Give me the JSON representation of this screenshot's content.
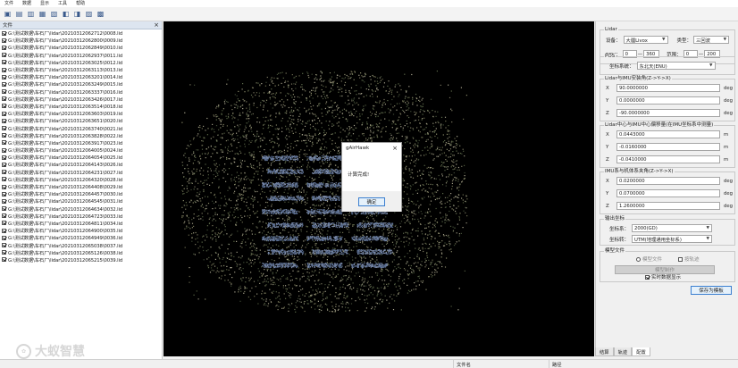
{
  "menu": [
    "文件",
    "数据",
    "显示",
    "工具",
    "帮助"
  ],
  "toolbar_icons": [
    "open-icon",
    "open-folder-icon",
    "save-icon",
    "import-icon",
    "export-icon",
    "layers-icon",
    "settings-icon",
    "image-icon",
    "view-icon"
  ],
  "file_panel": {
    "title": "文件",
    "close": "×",
    "files": [
      "G:\\测试数据\\车石厂\\lidar\\20210312062712\\0008.lid",
      "G:\\测试数据\\车石厂\\lidar\\20210312062800\\0009.lid",
      "G:\\测试数据\\车石厂\\lidar\\20210312062849\\0010.lid",
      "G:\\测试数据\\车石厂\\lidar\\20210312062937\\0011.lid",
      "G:\\测试数据\\车石厂\\lidar\\20210312063025\\0012.lid",
      "G:\\测试数据\\车石厂\\lidar\\20210312063113\\0013.lid",
      "G:\\测试数据\\车石厂\\lidar\\20210312063201\\0014.lid",
      "G:\\测试数据\\车石厂\\lidar\\20210312063249\\0015.lid",
      "G:\\测试数据\\车石厂\\lidar\\20210312063337\\0016.lid",
      "G:\\测试数据\\车石厂\\lidar\\20210312063426\\0017.lid",
      "G:\\测试数据\\车石厂\\lidar\\20210312063514\\0018.lid",
      "G:\\测试数据\\车石厂\\lidar\\20210312063603\\0019.lid",
      "G:\\测试数据\\车石厂\\lidar\\20210312063651\\0020.lid",
      "G:\\测试数据\\车石厂\\lidar\\20210312063740\\0021.lid",
      "G:\\测试数据\\车石厂\\lidar\\20210312063828\\0022.lid",
      "G:\\测试数据\\车石厂\\lidar\\20210312063917\\0023.lid",
      "G:\\测试数据\\车石厂\\lidar\\20210312064005\\0024.lid",
      "G:\\测试数据\\车石厂\\lidar\\20210312064054\\0025.lid",
      "G:\\测试数据\\车石厂\\lidar\\20210312064143\\0026.lid",
      "G:\\测试数据\\车石厂\\lidar\\20210312064231\\0027.lid",
      "G:\\测试数据\\车石厂\\lidar\\20210312064320\\0028.lid",
      "G:\\测试数据\\车石厂\\lidar\\20210312064408\\0029.lid",
      "G:\\测试数据\\车石厂\\lidar\\20210312064457\\0030.lid",
      "G:\\测试数据\\车石厂\\lidar\\20210312064545\\0031.lid",
      "G:\\测试数据\\车石厂\\lidar\\20210312064634\\0032.lid",
      "G:\\测试数据\\车石厂\\lidar\\20210312064723\\0033.lid",
      "G:\\测试数据\\车石厂\\lidar\\20210312064811\\0034.lid",
      "G:\\测试数据\\车石厂\\lidar\\20210312064900\\0035.lid",
      "G:\\测试数据\\车石厂\\lidar\\20210312064949\\0036.lid",
      "G:\\测试数据\\车石厂\\lidar\\20210312065038\\0037.lid",
      "G:\\测试数据\\车石厂\\lidar\\20210312065126\\0038.lid",
      "G:\\测试数据\\车石厂\\lidar\\20210312065215\\0039.lid"
    ]
  },
  "dialog": {
    "title": "gAirHawk",
    "close": "×",
    "message": "计算完成!",
    "ok_label": "确定"
  },
  "right_panel": {
    "lidar_group": "Lidar",
    "device_label": "设备：",
    "device_value": "大疆Livox",
    "type_label": "类型：",
    "type_value": "三回波",
    "fov_label": "FOV：",
    "fov_min": "0",
    "fov_dash": "—",
    "fov_max": "360",
    "range_label": "范围：",
    "range_min": "0",
    "range_max": "200",
    "pos_group": "POS",
    "coord_label": "坐标系统：",
    "coord_value": "东北天(ENU)",
    "lidar_rot_group": "Lidar与IMU安装角(Z->Y->X)",
    "rot": [
      {
        "axis": "X",
        "value": "90.0000000",
        "unit": "deg"
      },
      {
        "axis": "Y",
        "value": "0.0000000",
        "unit": "deg"
      },
      {
        "axis": "Z",
        "value": "-90.0000000",
        "unit": "deg"
      }
    ],
    "lidar_off_group": "Lidar中心与IMU中心偏移量(在IMU坐标系中测量)",
    "off": [
      {
        "axis": "X",
        "value": "0.0443000",
        "unit": "m"
      },
      {
        "axis": "Y",
        "value": "-0.0160000",
        "unit": "m"
      },
      {
        "axis": "Z",
        "value": "-0.0410000",
        "unit": "m"
      }
    ],
    "body_group": "IMU系与机体系夹角(Z->Y->X)",
    "body": [
      {
        "axis": "X",
        "value": "0.0200000",
        "unit": "deg"
      },
      {
        "axis": "Y",
        "value": "0.0700000",
        "unit": "deg"
      },
      {
        "axis": "Z",
        "value": "1.2600000",
        "unit": "deg"
      }
    ],
    "out_group": "输出坐标",
    "datum_label": "坐标系：",
    "datum_value": "2000(GD)",
    "proj_label": "坐标转：",
    "proj_value": "UTM(地理通用坐标系)",
    "model_group": "模型文件",
    "radio_label": "模型文件",
    "check_label": "按轨迹",
    "model_button": "模型制作",
    "realtime_label": "实时数据显示",
    "save_button": "保存为模板"
  },
  "bottom_tabs": [
    "结算",
    "轨迹",
    "配置"
  ],
  "status": {
    "file_label": "文件名",
    "path_label": "路径"
  },
  "watermark": "大蚁智慧",
  "colors": {
    "accent": "#3b7fd0",
    "viewport_bg": "#000000"
  }
}
